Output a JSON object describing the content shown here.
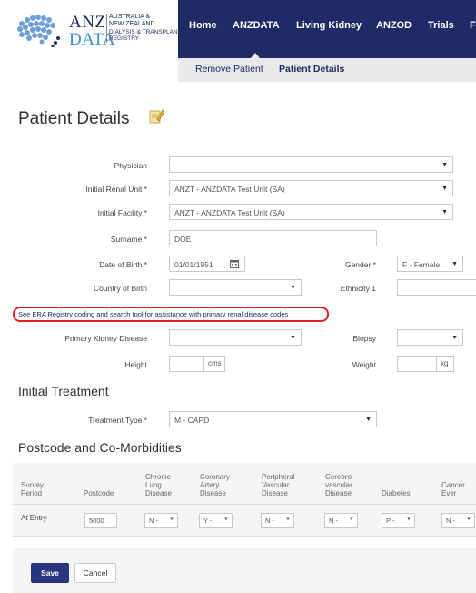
{
  "colors": {
    "nav_bg": "#1f2a66",
    "accent_blue": "#3d8fd6",
    "highlight_red": "#e02020",
    "save_button": "#2a3580"
  },
  "logo": {
    "anz": "ANZ",
    "data": "DATA",
    "line1": "AUSTRALIA &",
    "line2": "NEW ZEALAND",
    "line3": "DIALYSIS & TRANSPLANT",
    "line4": "REGISTRY"
  },
  "nav": {
    "items": [
      "Home",
      "ANZDATA",
      "Living Kidney",
      "ANZOD",
      "Trials",
      "F"
    ]
  },
  "subnav": {
    "remove_patient": "Remove Patient",
    "patient_details": "Patient Details"
  },
  "page": {
    "title": "Patient Details",
    "edit_icon": "edit-notepad-icon"
  },
  "form": {
    "physician_label": "Physician",
    "physician_value": "",
    "renal_unit_label": "Initial Renal Unit *",
    "renal_unit_value": "ANZT - ANZDATA Test Unit (SA)",
    "facility_label": "Initial Facility *",
    "facility_value": "ANZT - ANZDATA Test Unit (SA)",
    "surname_label": "Surname *",
    "surname_value": "DOE",
    "dob_label": "Date of Birth *",
    "dob_value": "01/01/1951",
    "gender_label": "Gender *",
    "gender_value": "F - Female",
    "country_label": "Country of Birth",
    "country_value": "",
    "ethnicity_label": "Ethnicity 1",
    "ethnicity_value": "",
    "era_link": "See ERA Registry coding and search tool for assistance with primary renal disease codes",
    "pkd_label": "Primary Kidney Disease",
    "pkd_value": "",
    "biopsy_label": "Biopsy",
    "biopsy_value": "",
    "height_label": "Height",
    "height_value": "",
    "height_unit": "cms",
    "weight_label": "Weight",
    "weight_value": "",
    "weight_unit": "kg"
  },
  "treatment": {
    "section_title": "Initial Treatment",
    "type_label": "Treatment Type *",
    "type_value": "M - CAPD"
  },
  "comorbidities": {
    "section_title": "Postcode and Co-Morbidities",
    "headers": {
      "survey": [
        "Survey",
        "Period"
      ],
      "postcode": [
        "Postcode"
      ],
      "lung": [
        "Chronic",
        "Lung",
        "Disease"
      ],
      "coronary": [
        "Coronary",
        "Artery",
        "Disease"
      ],
      "peripheral": [
        "Peripheral",
        "Vascular",
        "Disease"
      ],
      "cerebro": [
        "Cerebro-",
        "vascular",
        "Disease"
      ],
      "diabetes": [
        "Diabetes"
      ],
      "cancer": [
        "Cancer",
        "Ever"
      ]
    },
    "row": {
      "survey_period": "At Entry",
      "postcode": "5000",
      "lung": "N -",
      "coronary": "Y -",
      "peripheral": "N -",
      "cerebro": "N -",
      "diabetes": "P -",
      "cancer": "N -"
    }
  },
  "actions": {
    "save": "Save",
    "cancel": "Cancel"
  }
}
